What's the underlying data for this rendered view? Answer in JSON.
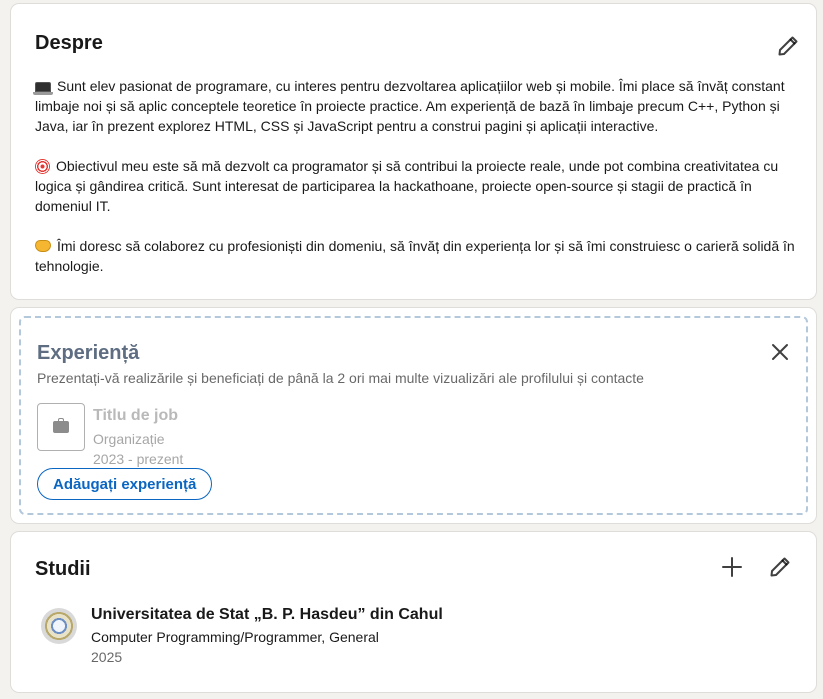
{
  "about": {
    "title": "Despre",
    "edit_icon": "pencil-icon",
    "paragraphs": [
      {
        "emoji": "laptop-emoji",
        "text": "Sunt elev pasionat de programare, cu interes pentru dezvoltarea aplicațiilor web și mobile. Îmi place să învăț constant limbaje noi și să aplic conceptele teoretice în proiecte practice. Am experiență de bază în limbaje precum C++, Python și Java, iar în prezent explorez HTML, CSS și JavaScript pentru a construi pagini și aplicații interactive."
      },
      {
        "emoji": "target-emoji",
        "text": "Obiectivul meu este să mă dezvolt ca programator și să contribui la proiecte reale, unde pot combina creativitatea cu logica și gândirea critică. Sunt interesat de participarea la hackathoane, proiecte open-source și stagii de practică în domeniul IT."
      },
      {
        "emoji": "handshake-emoji",
        "text": "Îmi doresc să colaborez cu profesioniști din domeniu, să învăț din experiența lor și să îmi construiesc o carieră solidă în tehnologie."
      }
    ]
  },
  "experience": {
    "title": "Experiență",
    "subtitle": "Prezentați-vă realizările și beneficiați de până la 2 ori mai multe vizualizări ale profilului și contacte",
    "close_icon": "close-icon",
    "placeholder": {
      "job_title": "Titlu de job",
      "organization": "Organizație",
      "dates": "2023 - prezent",
      "logo_icon": "briefcase-icon"
    },
    "add_button": "Adăugați experiență"
  },
  "education": {
    "title": "Studii",
    "add_icon": "plus-icon",
    "edit_icon": "pencil-icon",
    "school": {
      "name": "Universitatea de Stat „B. P. Hasdeu” din Cahul",
      "degree": "Computer Programming/Programmer, General",
      "year": "2025"
    }
  },
  "colors": {
    "background": "#f4f2ee",
    "card": "#ffffff",
    "accent": "#0a66c2",
    "dashed_border": "#b4c8dc",
    "experience_title": "#5e6d81"
  }
}
